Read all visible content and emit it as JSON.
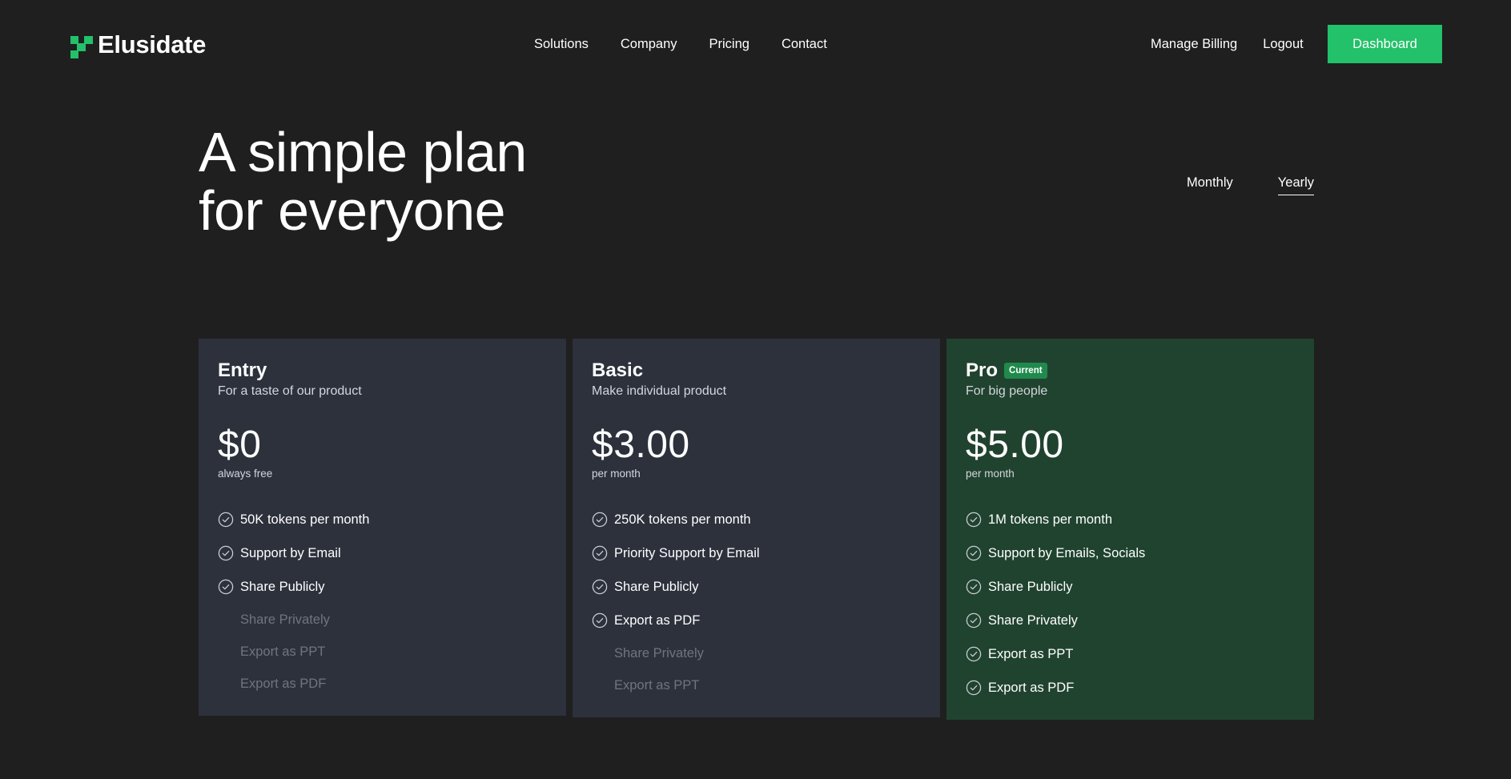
{
  "brand": {
    "name": "Elusidate",
    "accent": "#22c16a"
  },
  "nav": {
    "links": [
      "Solutions",
      "Company",
      "Pricing",
      "Contact"
    ],
    "manage_billing": "Manage Billing",
    "logout": "Logout",
    "dashboard": "Dashboard"
  },
  "hero": {
    "title_line1": "A simple plan",
    "title_line2": "for everyone"
  },
  "period": {
    "monthly": "Monthly",
    "yearly": "Yearly",
    "selected": "Yearly"
  },
  "plans": [
    {
      "name": "Entry",
      "description": "For a taste of our product",
      "price": "$0",
      "price_note": "always free",
      "features": [
        {
          "text": "50K tokens per month",
          "included": true
        },
        {
          "text": "Support by Email",
          "included": true
        },
        {
          "text": "Share Publicly",
          "included": true
        },
        {
          "text": "Share Privately",
          "included": false
        },
        {
          "text": "Export as PPT",
          "included": false
        },
        {
          "text": "Export as PDF",
          "included": false
        }
      ]
    },
    {
      "name": "Basic",
      "description": "Make individual product",
      "price": "$3.00",
      "price_note": "per month",
      "features": [
        {
          "text": "250K tokens per month",
          "included": true
        },
        {
          "text": "Priority Support by Email",
          "included": true
        },
        {
          "text": "Share Publicly",
          "included": true
        },
        {
          "text": "Export as PDF",
          "included": true
        },
        {
          "text": "Share Privately",
          "included": false
        },
        {
          "text": "Export as PPT",
          "included": false
        }
      ]
    },
    {
      "name": "Pro",
      "badge": "Current",
      "description": "For big people",
      "price": "$5.00",
      "price_note": "per month",
      "features": [
        {
          "text": "1M tokens per month",
          "included": true
        },
        {
          "text": "Support by Emails, Socials",
          "included": true
        },
        {
          "text": "Share Publicly",
          "included": true
        },
        {
          "text": "Share Privately",
          "included": true
        },
        {
          "text": "Export as PPT",
          "included": true
        },
        {
          "text": "Export as PDF",
          "included": true
        }
      ]
    }
  ],
  "icons": {
    "feature_check": "check-circle-icon",
    "logo": "logo-mark-icon"
  }
}
